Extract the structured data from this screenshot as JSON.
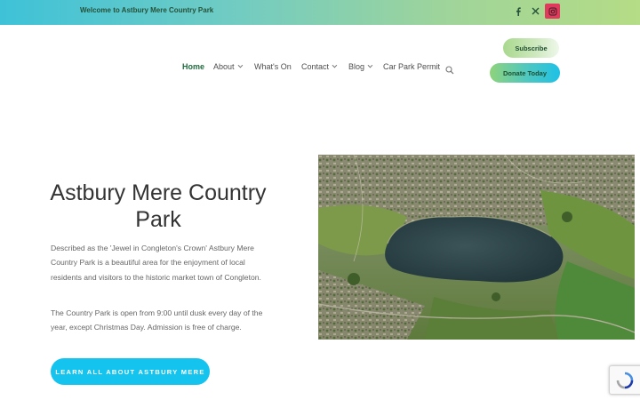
{
  "topbar": {
    "welcome": "Welcome to Astbury Mere Country Park",
    "social": [
      "facebook-icon",
      "x-icon",
      "instagram-icon"
    ]
  },
  "nav": {
    "items": [
      {
        "label": "Home",
        "active": true
      },
      {
        "label": "About",
        "dropdown": true
      },
      {
        "label": "What's On"
      },
      {
        "label": "Contact",
        "dropdown": true
      },
      {
        "label": "Blog",
        "dropdown": true
      },
      {
        "label": "Car Park Permit"
      }
    ]
  },
  "buttons": {
    "subscribe": "Subscribe",
    "donate": "Donate Today"
  },
  "hero": {
    "title": "Astbury Mere Country Park",
    "paragraph1": "Described as the 'Jewel in Congleton's Crown' Astbury Mere Country Park is a beautiful area for the enjoyment of local residents and visitors to the historic market town of Congleton.",
    "paragraph2": "The Country Park is open from 9:00 until dusk every day of the year, except Christmas Day.  Admission is free of charge.",
    "cta": "LEARN ALL ABOUT ASTBURY MERE"
  },
  "colors": {
    "brand_green": "#1f6b3e",
    "accent_blue": "#15c3ef",
    "instagram": "#e03a5c"
  }
}
